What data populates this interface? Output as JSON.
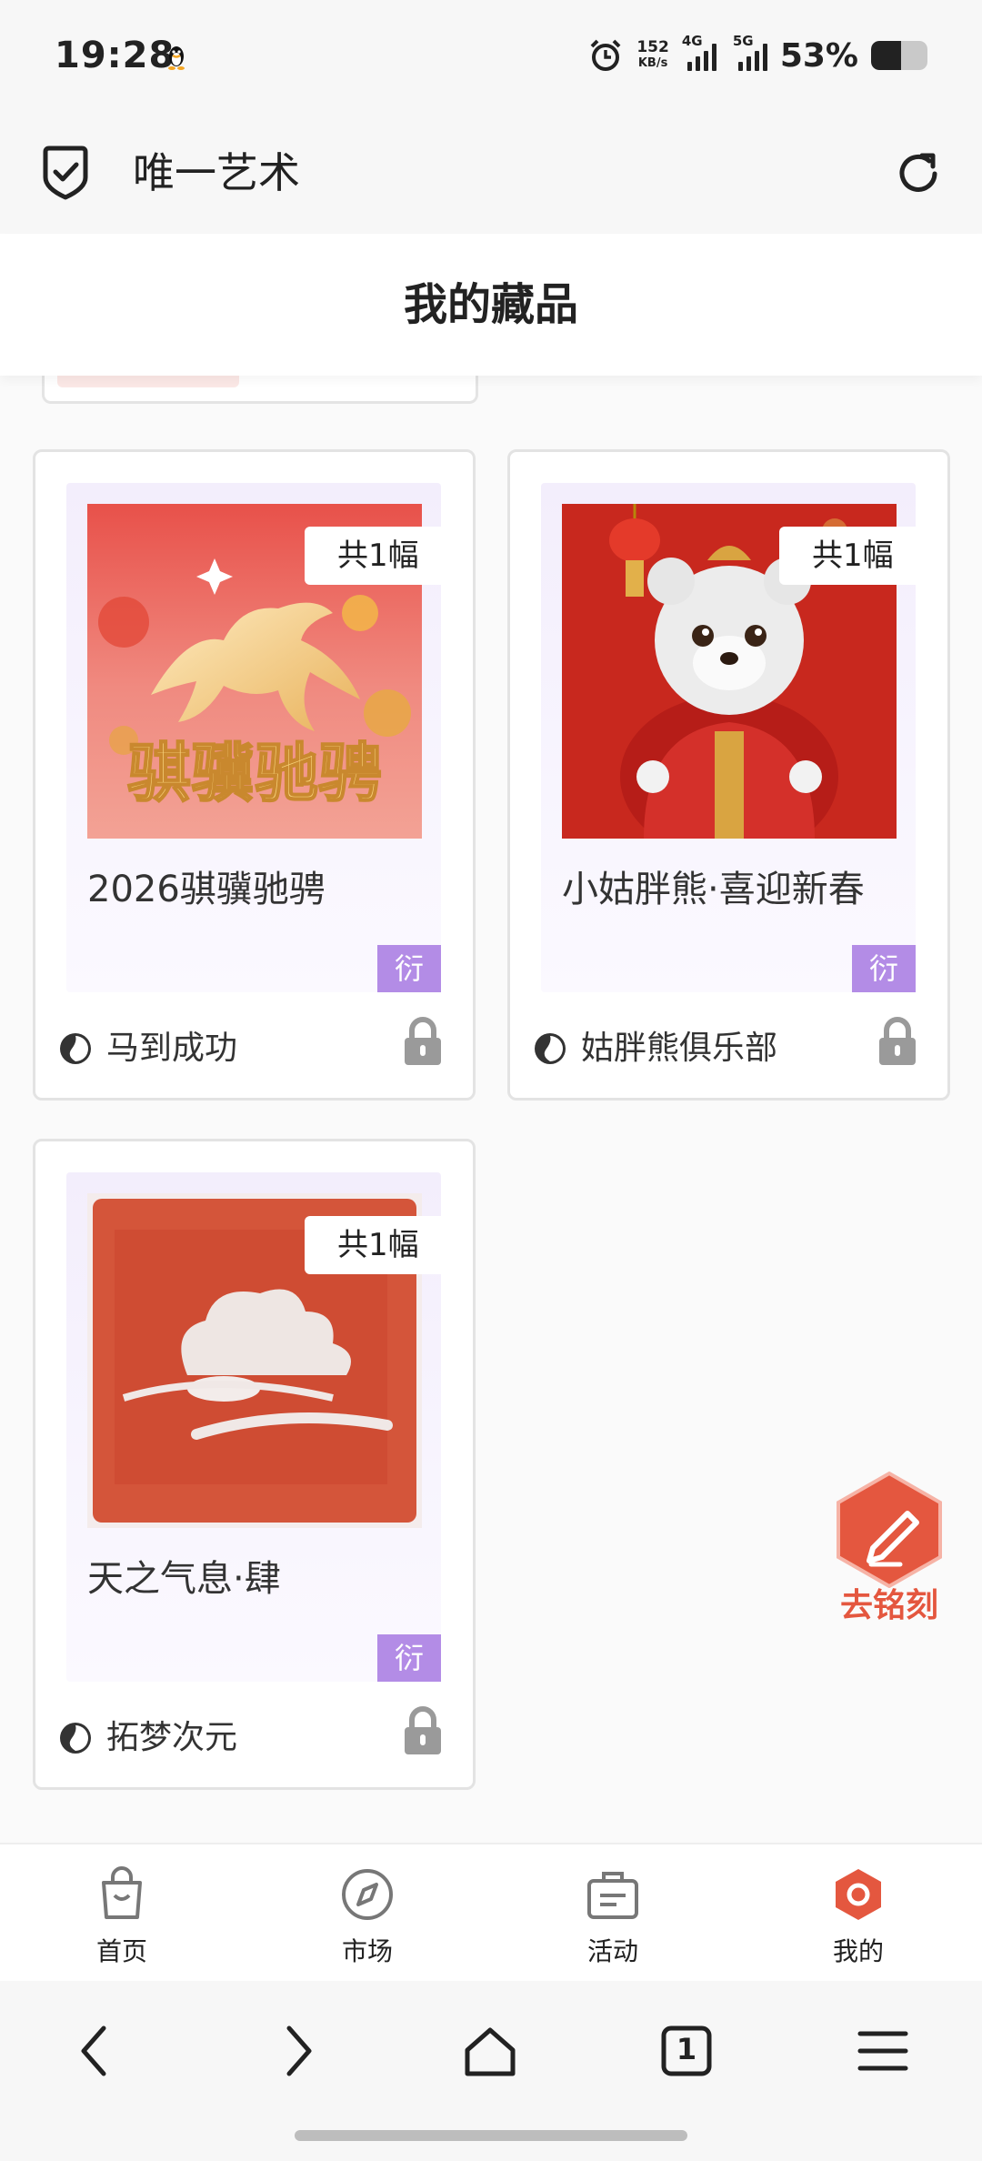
{
  "status_bar": {
    "time": "19:28",
    "net_speed_value": "152",
    "net_speed_unit": "KB/s",
    "sim1_label": "4G",
    "sim2_label": "5G",
    "battery_percent": "53%",
    "battery_level": 0.53
  },
  "header": {
    "app_name": "唯一艺术",
    "icons": [
      "shield-check-icon",
      "refresh-icon"
    ]
  },
  "page": {
    "title": "我的藏品"
  },
  "collection": [
    {
      "count_label": "共1幅",
      "name": "2026骐骥驰骋",
      "tag": "衍",
      "creator": "马到成功",
      "locked": true,
      "art_text": "骐骥驰骋"
    },
    {
      "count_label": "共1幅",
      "name": "小姑胖熊·喜迎新春",
      "tag": "衍",
      "creator": "姑胖熊俱乐部",
      "locked": true
    },
    {
      "count_label": "共1幅",
      "name": "天之气息·肆",
      "tag": "衍",
      "creator": "拓梦次元",
      "locked": true
    }
  ],
  "floating_action": {
    "label": "去铭刻",
    "icon": "pen-icon"
  },
  "tabbar": {
    "active": "我的",
    "items": [
      {
        "label": "首页",
        "icon": "shopping-bag-icon"
      },
      {
        "label": "市场",
        "icon": "compass-icon"
      },
      {
        "label": "活动",
        "icon": "briefcase-icon"
      },
      {
        "label": "我的",
        "icon": "profile-hex-icon"
      }
    ]
  },
  "browser": {
    "tab_count": "1",
    "icons": [
      "back-icon",
      "forward-icon",
      "home-icon",
      "tabs-icon",
      "menu-icon"
    ]
  },
  "colors": {
    "accent": "#e4573f",
    "tag_purple": "#b38ce6"
  }
}
